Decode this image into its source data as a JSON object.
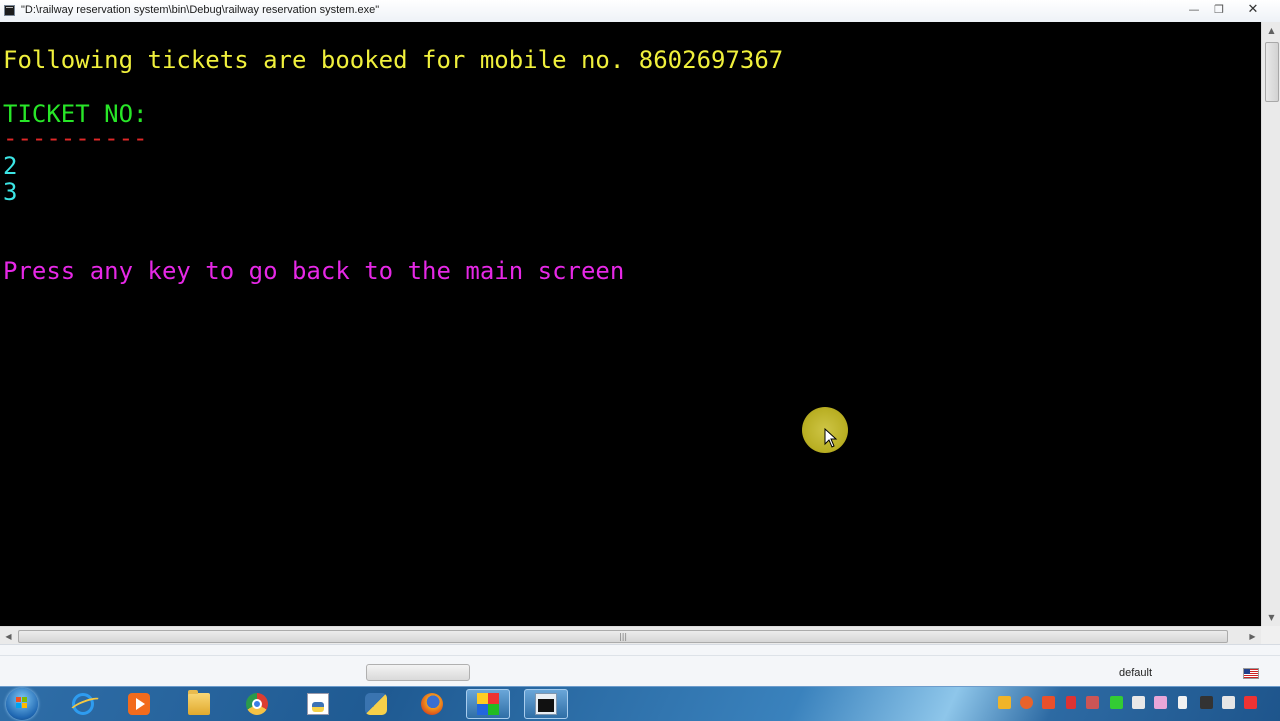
{
  "window": {
    "title": "\"D:\\railway reservation system\\bin\\Debug\\railway reservation system.exe\"",
    "minimize_glyph": "—",
    "maximize_glyph": "❐",
    "close_glyph": "✕"
  },
  "console": {
    "heading": "Following tickets are booked for mobile no. 8602697367",
    "ticket_label": "TICKET NO:",
    "separator": "----------",
    "tickets": [
      "2",
      "3"
    ],
    "prompt": "Press any key to go back to the main screen"
  },
  "scrollbars": {
    "up": "▲",
    "down": "▼",
    "left": "◀",
    "right": "▶",
    "grip": "|||"
  },
  "status_strip": {
    "text": "default"
  },
  "taskbar": {
    "apps": [
      {
        "icon": "internet-explorer-icon"
      },
      {
        "icon": "media-player-icon"
      },
      {
        "icon": "file-explorer-icon"
      },
      {
        "icon": "chrome-icon"
      },
      {
        "icon": "document-icon"
      },
      {
        "icon": "python-icon"
      },
      {
        "icon": "firefox-icon"
      },
      {
        "icon": "codeblocks-icon"
      },
      {
        "icon": "console-window-icon"
      }
    ]
  },
  "colors": {
    "console_bg": "#000000",
    "heading": "#f0f03c",
    "ticket_label": "#28e628",
    "separator": "#e02828",
    "ticket_values": "#3ce6e6",
    "prompt": "#e628e6",
    "cursor_highlight": "#d8cc3a"
  }
}
